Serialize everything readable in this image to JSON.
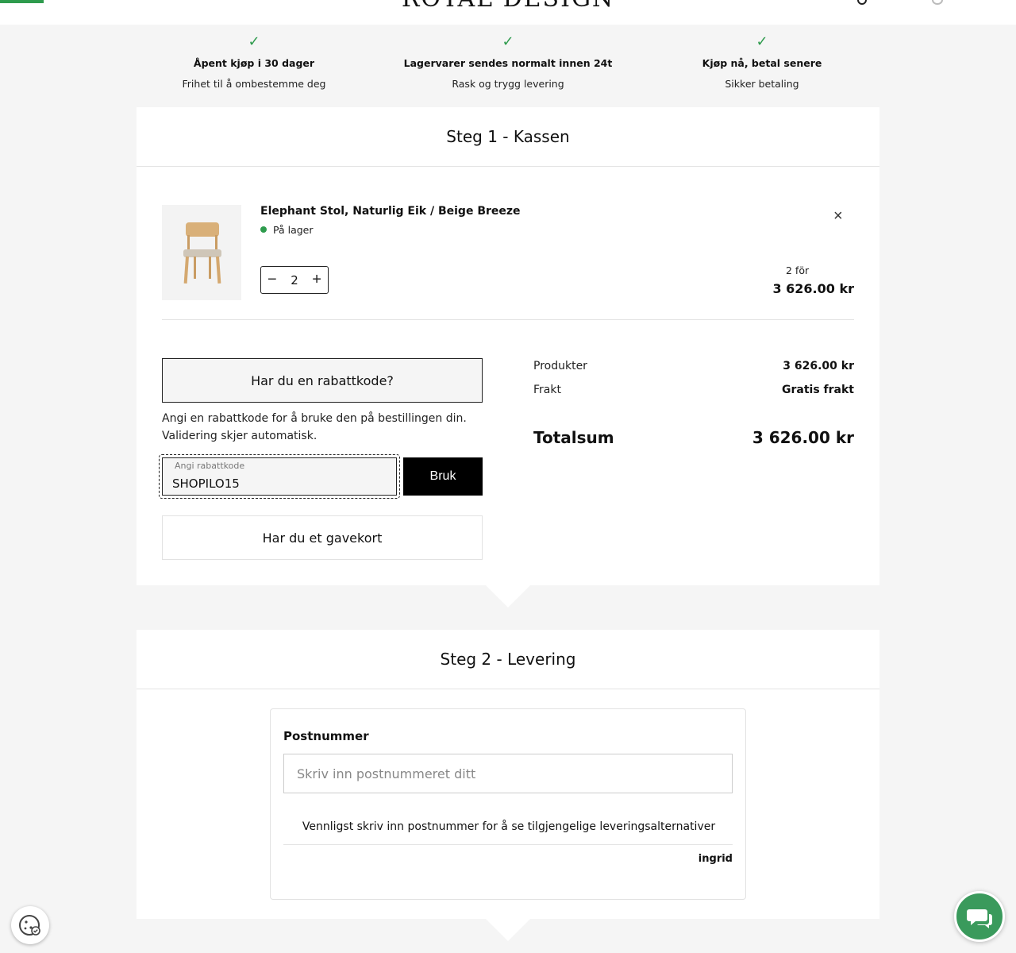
{
  "header": {
    "logo": "ROYAL DESIGN"
  },
  "usps": [
    {
      "title": "Åpent kjøp i 30 dager",
      "subtitle": "Frihet til å ombestemme deg"
    },
    {
      "title": "Lagervarer sendes normalt innen 24t",
      "subtitle": "Rask og trygg levering"
    },
    {
      "title": "Kjøp nå, betal senere",
      "subtitle": "Sikker betaling"
    }
  ],
  "step1": {
    "title": "Steg 1 - Kassen",
    "item": {
      "name": "Elephant Stol, Naturlig Eik / Beige Breeze",
      "stock": "På lager",
      "quantity": "2",
      "price_label": "2 för",
      "price": "3 626.00 kr",
      "remove_symbol": "×",
      "minus_symbol": "−",
      "plus_symbol": "+"
    },
    "discount": {
      "toggle_label": "Har du en rabattkode?",
      "help_line1": "Angi en rabattkode for å bruke den på bestillingen din.",
      "help_line2": "Validering skjer automatisk.",
      "field_label": "Angi rabattkode",
      "field_value": "SHOPILO15",
      "apply_label": "Bruk"
    },
    "giftcard_label": "Har du et gavekort",
    "summary": {
      "products_label": "Produkter",
      "products_value": "3 626.00 kr",
      "shipping_label": "Frakt",
      "shipping_value": "Gratis frakt",
      "total_label": "Totalsum",
      "total_value": "3 626.00 kr"
    }
  },
  "step2": {
    "title": "Steg 2 - Levering",
    "postcode_label": "Postnummer",
    "postcode_placeholder": "Skriv inn postnummeret ditt",
    "note": "Vennligst skriv inn postnummer for å se tilgjengelige leveringsalternativer",
    "brand": "ingrid"
  },
  "colors": {
    "accent": "#2e9b4d",
    "chat": "#3a9a5c"
  }
}
